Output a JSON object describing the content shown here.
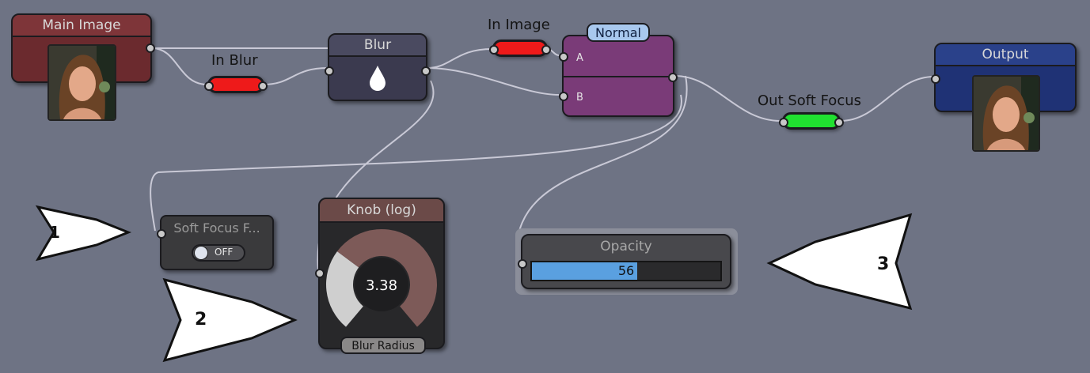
{
  "nodes": {
    "main_image": {
      "title": "Main Image"
    },
    "blur": {
      "title": "Blur"
    },
    "blend": {
      "mode_badge": "Normal",
      "port_a": "A",
      "port_b": "B"
    },
    "output": {
      "title": "Output"
    },
    "soft_focus": {
      "title": "Soft Focus F...",
      "toggle_label": "OFF"
    },
    "knob": {
      "title": "Knob (log)",
      "value": "3.38",
      "caption": "Blur Radius",
      "fill_fraction": 0.69
    },
    "opacity": {
      "title": "Opacity",
      "value": "56",
      "fill_fraction": 0.56
    }
  },
  "wire_labels": {
    "in_blur": "In Blur",
    "in_image": "In Image",
    "out_soft_focus": "Out Soft Focus"
  },
  "annotations": [
    "1",
    "2",
    "3"
  ],
  "colors": {
    "canvas": "#6e7384",
    "main_image": "#6b2a2e",
    "blur": "#3b3a4f",
    "blend": "#7a3b78",
    "output": "#1f3275",
    "input_pill": "#ee1a1a",
    "output_pill": "#20e030",
    "bar_fill": "#5aa0e0",
    "knob_ring": "#7d5a58"
  }
}
